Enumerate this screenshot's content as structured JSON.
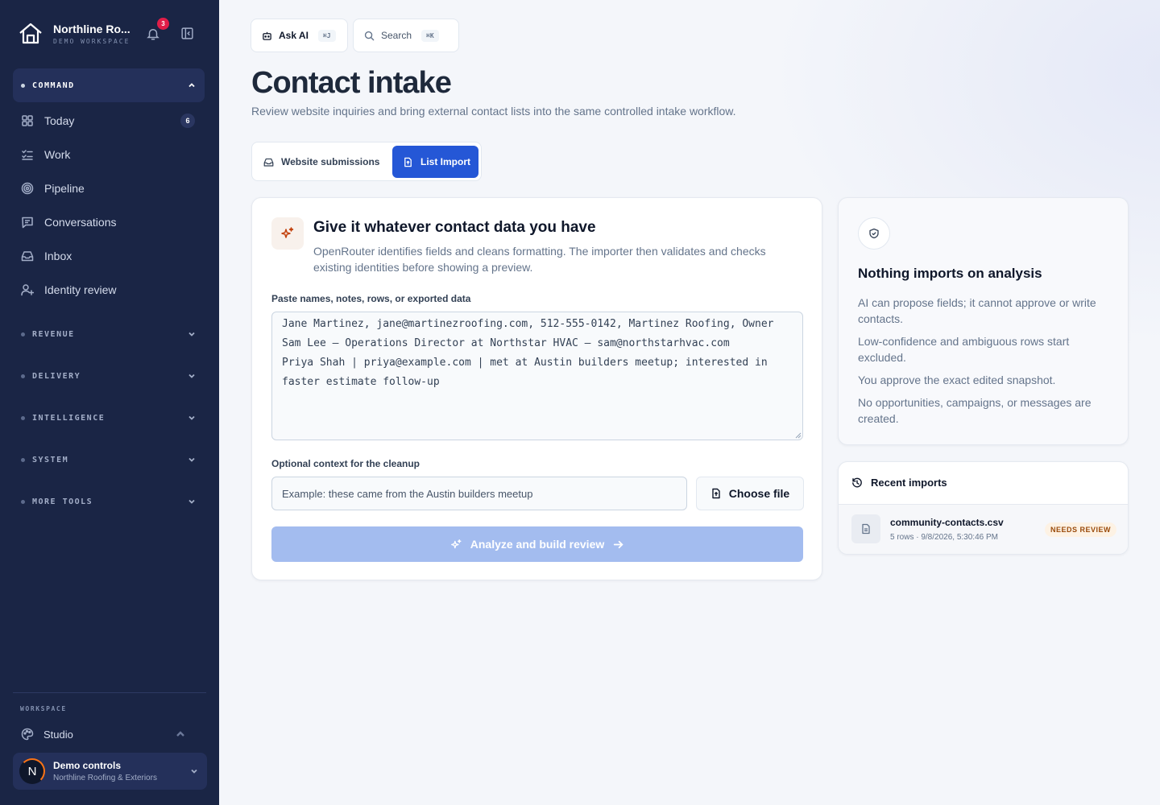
{
  "workspace": {
    "name": "Northline Ro...",
    "subtitle": "DEMO WORKSPACE",
    "notification_count": "3"
  },
  "sidebar": {
    "command_section": "COMMAND",
    "items": [
      {
        "label": "Today",
        "icon": "grid-icon",
        "count": "6"
      },
      {
        "label": "Work",
        "icon": "checklist-icon"
      },
      {
        "label": "Pipeline",
        "icon": "target-icon"
      },
      {
        "label": "Conversations",
        "icon": "message-icon"
      },
      {
        "label": "Inbox",
        "icon": "inbox-icon"
      },
      {
        "label": "Identity review",
        "icon": "user-plus-icon"
      }
    ],
    "sections": [
      "REVENUE",
      "DELIVERY",
      "INTELLIGENCE",
      "SYSTEM",
      "MORE TOOLS"
    ],
    "workspace_label": "WORKSPACE",
    "studio_label": "Studio",
    "demo": {
      "title": "Demo controls",
      "subtitle": "Northline Roofing & Exteriors",
      "avatar_letter": "N"
    }
  },
  "topbar": {
    "ask_ai": "Ask AI",
    "ask_ai_kbd": "⌘J",
    "search": "Search",
    "search_kbd": "⌘K"
  },
  "page": {
    "title": "Contact intake",
    "description": "Review website inquiries and bring external contact lists into the same controlled intake workflow."
  },
  "tabs": {
    "website": "Website submissions",
    "list_import": "List Import",
    "active": "list_import"
  },
  "import_card": {
    "heading": "Give it whatever contact data you have",
    "subtext": "OpenRouter identifies fields and cleans formatting. The importer then validates and checks existing identities before showing a preview.",
    "paste_label": "Paste names, notes, rows, or exported data",
    "paste_value": "Jane Martinez, jane@martinezroofing.com, 512-555-0142, Martinez Roofing, Owner\nSam Lee — Operations Director at Northstar HVAC — sam@northstarhvac.com\nPriya Shah | priya@example.com | met at Austin builders meetup; interested in faster estimate follow-up",
    "context_label": "Optional context for the cleanup",
    "context_placeholder": "Example: these came from the Austin builders meetup",
    "choose_file": "Choose file",
    "analyze": "Analyze and build review"
  },
  "info_card": {
    "heading": "Nothing imports on analysis",
    "points": [
      "AI can propose fields; it cannot approve or write contacts.",
      "Low-confidence and ambiguous rows start excluded.",
      "You approve the exact edited snapshot.",
      "No opportunities, campaigns, or messages are created."
    ]
  },
  "recent": {
    "heading": "Recent imports",
    "items": [
      {
        "file": "community-contacts.csv",
        "meta": "5 rows · 9/8/2026, 5:30:46 PM",
        "status": "NEEDS REVIEW"
      }
    ]
  },
  "colors": {
    "sidebar_bg": "#1a2545",
    "accent": "#2557d6",
    "disabled_button": "#a3bcef",
    "badge_text": "#9a4a0a",
    "notification_badge": "#e11d48"
  }
}
